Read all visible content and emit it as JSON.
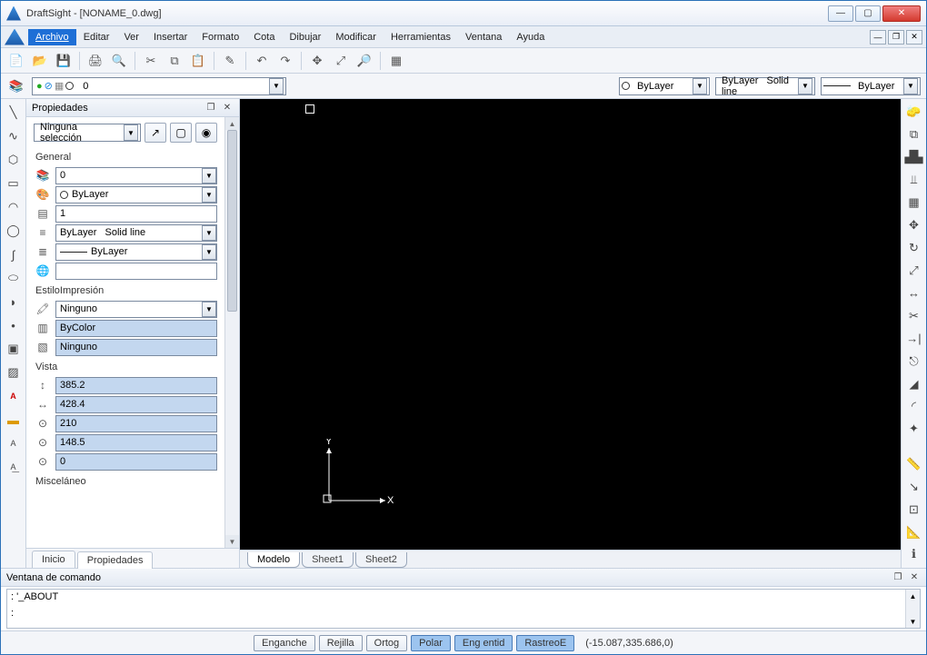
{
  "title": "DraftSight - [NONAME_0.dwg]",
  "menu": {
    "archivo": "Archivo",
    "editar": "Editar",
    "ver": "Ver",
    "insertar": "Insertar",
    "formato": "Formato",
    "cota": "Cota",
    "dibujar": "Dibujar",
    "modificar": "Modificar",
    "herramientas": "Herramientas",
    "ventana": "Ventana",
    "ayuda": "Ayuda"
  },
  "layerbar": {
    "layer": "0",
    "color": "ByLayer",
    "style": "ByLayer",
    "linetype": "Solid line",
    "weight": "ByLayer"
  },
  "properties": {
    "title": "Propiedades",
    "selection": "Ninguna selección",
    "general": {
      "header": "General",
      "layer": "0",
      "color": "ByLayer",
      "scale": "1",
      "style": "ByLayer",
      "linetype": "Solid line",
      "weight": "ByLayer",
      "hyperlink": ""
    },
    "printstyle": {
      "header": "EstiloImpresión",
      "style": "Ninguno",
      "bycolor": "ByColor",
      "none": "Ninguno"
    },
    "view": {
      "header": "Vista",
      "v1": "385.2",
      "v2": "428.4",
      "v3": "210",
      "v4": "148.5",
      "v5": "0"
    },
    "misc": {
      "header": "Misceláneo"
    }
  },
  "tabs": {
    "inicio": "Inicio",
    "propiedades": "Propiedades"
  },
  "modeltabs": {
    "modelo": "Modelo",
    "sheet1": "Sheet1",
    "sheet2": "Sheet2"
  },
  "command": {
    "title": "Ventana de comando",
    "line1": ": '_ABOUT",
    "prompt": ":"
  },
  "status": {
    "enganche": "Enganche",
    "rejilla": "Rejilla",
    "ortog": "Ortog",
    "polar": "Polar",
    "engentid": "Eng entid",
    "rastreoe": "RastreoE",
    "coords": "(-15.087,335.686,0)"
  },
  "ucs": {
    "x": "X",
    "y": "Y"
  }
}
